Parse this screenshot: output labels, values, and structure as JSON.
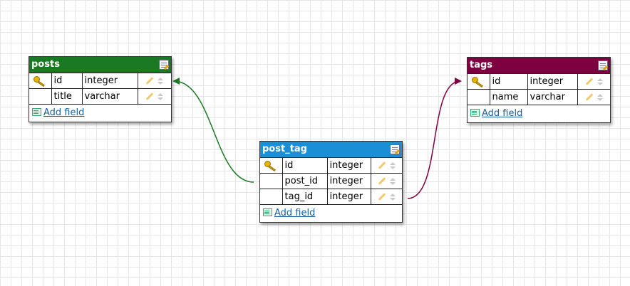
{
  "tables": [
    {
      "name": "posts",
      "color": "#1a7a23",
      "fields": [
        {
          "key": true,
          "name": "id",
          "type": "integer"
        },
        {
          "key": false,
          "name": "title",
          "type": "varchar"
        }
      ],
      "add_label": "Add field"
    },
    {
      "name": "tags",
      "color": "#7f0040",
      "fields": [
        {
          "key": true,
          "name": "id",
          "type": "integer"
        },
        {
          "key": false,
          "name": "name",
          "type": "varchar"
        }
      ],
      "add_label": "Add field"
    },
    {
      "name": "post_tag",
      "color": "#1b8fd6",
      "fields": [
        {
          "key": true,
          "name": "id",
          "type": "integer"
        },
        {
          "key": false,
          "name": "post_id",
          "type": "integer"
        },
        {
          "key": false,
          "name": "tag_id",
          "type": "integer"
        }
      ],
      "add_label": "Add field"
    }
  ],
  "relations": [
    {
      "from": "post_tag.post_id",
      "to": "posts.id",
      "color": "#1a7a23"
    },
    {
      "from": "post_tag.tag_id",
      "to": "tags.id",
      "color": "#7f0040"
    }
  ]
}
